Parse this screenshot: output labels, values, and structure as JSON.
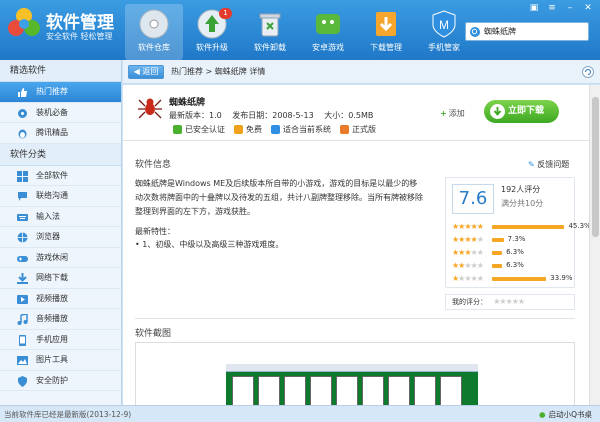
{
  "app": {
    "title": "软件管理",
    "slogan": "安全软件 轻松管理"
  },
  "nav": [
    {
      "label": "软件仓库"
    },
    {
      "label": "软件升级",
      "badge": "1"
    },
    {
      "label": "软件卸载"
    },
    {
      "label": "安卓游戏"
    },
    {
      "label": "下载管理"
    },
    {
      "label": "手机管家"
    }
  ],
  "search": {
    "value": "蜘蛛纸牌"
  },
  "sidebar": {
    "section1": "精选软件",
    "items1": [
      {
        "label": "热门推荐",
        "icon": "thumb-icon"
      },
      {
        "label": "装机必备",
        "icon": "gear-icon"
      },
      {
        "label": "腾讯精品",
        "icon": "penguin-icon"
      }
    ],
    "section2": "软件分类",
    "items2": [
      {
        "label": "全部软件",
        "icon": "grid-icon"
      },
      {
        "label": "联络沟通",
        "icon": "chat-icon"
      },
      {
        "label": "输入法",
        "icon": "keyboard-icon"
      },
      {
        "label": "浏览器",
        "icon": "browser-icon"
      },
      {
        "label": "游戏休闲",
        "icon": "gamepad-icon"
      },
      {
        "label": "网络下载",
        "icon": "download-icon"
      },
      {
        "label": "视频播放",
        "icon": "video-icon"
      },
      {
        "label": "音频播放",
        "icon": "music-icon"
      },
      {
        "label": "手机应用",
        "icon": "phone-icon"
      },
      {
        "label": "图片工具",
        "icon": "image-icon"
      },
      {
        "label": "安全防护",
        "icon": "shield-icon"
      }
    ]
  },
  "toolbar": {
    "back_label": "返回",
    "breadcrumb": "热门推荐 > 蜘蛛纸牌 详情"
  },
  "detail": {
    "name": "蜘蛛纸牌",
    "version": "最新版本：1.0",
    "date": "发布日期：2008-5-13",
    "size": "大小：0.5MB",
    "tags": [
      "已安全认证",
      "免费",
      "适合当前系统",
      "正式版"
    ],
    "add_label": "添加",
    "download_label": "立即下载",
    "info_title": "软件信息",
    "feedback_label": "反馈问题",
    "description": "蜘蛛纸牌是Windows ME及后续版本所自带的小游戏，游戏的目标是以最少的移动次数将牌面中的十叠牌以及待发的五组，共计八副牌整理移除。当所有牌被移除整理到界面的左下方，游戏获胜。",
    "features_title": "最新特性：",
    "features": "• 1、初级、中级以及高级三种游戏难度。",
    "screenshot_title": "软件截图"
  },
  "rating": {
    "score": "7.6",
    "count_label": "192人评分",
    "max_label": "满分共10分",
    "distribution": [
      {
        "stars": 5,
        "percent": 45.3,
        "label": "45.3%"
      },
      {
        "stars": 4,
        "percent": 7.3,
        "label": "7.3%"
      },
      {
        "stars": 3,
        "percent": 6.3,
        "label": "6.3%"
      },
      {
        "stars": 2,
        "percent": 6.3,
        "label": "6.3%"
      },
      {
        "stars": 1,
        "percent": 33.9,
        "label": "33.9%"
      }
    ],
    "my_rating_label": "我的评分："
  },
  "status": {
    "left": "当前软件库已经是最新版(2013-12-9)",
    "right": "启动小Q书桌"
  },
  "colors": {
    "header": "#2a87d3",
    "download": "#4cb52c",
    "star": "#f5a623"
  }
}
